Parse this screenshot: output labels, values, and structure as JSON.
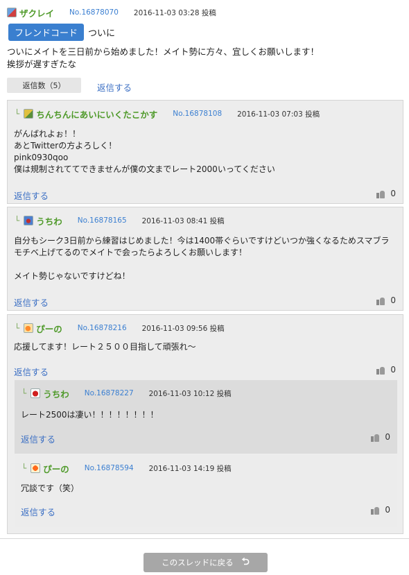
{
  "post": {
    "username": "ザクレイ",
    "number": "No.16878070",
    "date": "2016-11-03 03:28",
    "posted": "投稿",
    "badge": "フレンドコード",
    "title": "ついに",
    "body": "ついにメイトを三日前から始めました！メイト勢に方々、宜しくお願いします！\n挨拶が遅すぎたな",
    "reply_count": "返信数（5）",
    "reply_link": "返信する"
  },
  "replies": [
    {
      "username": "ちんちんにあいにいくたこかす",
      "number": "No.16878108",
      "date": "2016-11-03 07:03",
      "posted": "投稿",
      "body": "がんばれよぉ！！\nあとTwitterの方よろしく！\npink0930qoo\n僕は規制されててできませんが僕の文までレート2000いってください",
      "reply": "返信する",
      "likes": "0"
    },
    {
      "username": "うちわ",
      "number": "No.16878165",
      "date": "2016-11-03 08:41",
      "posted": "投稿",
      "body": "自分もシーク3日前から練習はじめました！今は1400帯ぐらいですけどいつか強くなるためスマブラモチベ上げてるのでメイトで会ったらよろしくお願いします！\n\nメイト勢じゃないですけどね！",
      "reply": "返信する",
      "likes": "0"
    },
    {
      "username": "ぴーの",
      "number": "No.16878216",
      "date": "2016-11-03 09:56",
      "posted": "投稿",
      "body": "応援してます！レート２５００目指して頑張れ〜",
      "reply": "返信する",
      "likes": "0"
    },
    {
      "username": "うちわ",
      "number": "No.16878227",
      "date": "2016-11-03 10:12",
      "posted": "投稿",
      "body": "レート2500は凄い！！！！！！！！",
      "reply": "返信する",
      "likes": "0"
    },
    {
      "username": "ぴーの",
      "number": "No.16878594",
      "date": "2016-11-03 14:19",
      "posted": "投稿",
      "body": "冗談です（笑）",
      "reply": "返信する",
      "likes": "0"
    }
  ],
  "footer": {
    "back_label": "このスレッドに戻る",
    "back_icon": "return-arrow-icon"
  },
  "colors": {
    "accent_blue": "#3a7fcf",
    "username_green": "#4f9a2a",
    "link_blue": "#3b6fc4",
    "button_gray": "#a7a7a7"
  }
}
